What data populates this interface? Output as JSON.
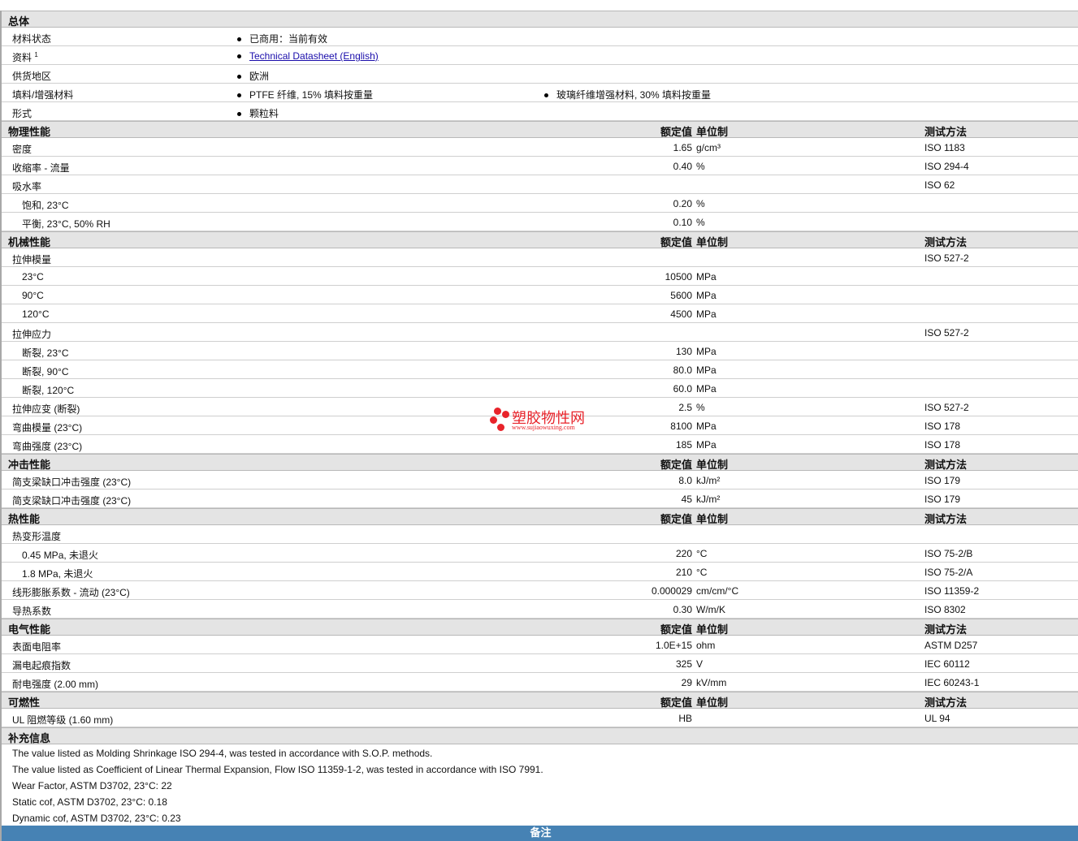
{
  "general": {
    "title": "总体",
    "rows": [
      {
        "label": "材料状态",
        "items": [
          "已商用：当前有效"
        ]
      },
      {
        "label": "资料",
        "sup": "1",
        "items": [
          "Technical Datasheet (English)"
        ],
        "link": true
      },
      {
        "label": "供货地区",
        "items": [
          "欧洲"
        ]
      },
      {
        "label": "填料/增强材料",
        "items": [
          "PTFE 纤维, 15% 填料按重量",
          "玻璃纤维增强材料, 30% 填料按重量"
        ]
      },
      {
        "label": "形式",
        "items": [
          "颗粒料"
        ]
      }
    ]
  },
  "headers": {
    "value": "额定值",
    "unit": "单位制",
    "method": "测试方法"
  },
  "sections": [
    {
      "title": "物理性能",
      "rows": [
        {
          "label": "密度",
          "value": "1.65",
          "unit": "g/cm³",
          "method": "ISO 1183"
        },
        {
          "label": "收缩率 - 流量",
          "value": "0.40",
          "unit": "%",
          "method": "ISO 294-4"
        },
        {
          "label": "吸水率",
          "method": "ISO 62"
        },
        {
          "label": "饱和, 23°C",
          "indent": true,
          "value": "0.20",
          "unit": "%"
        },
        {
          "label": "平衡, 23°C, 50% RH",
          "indent": true,
          "value": "0.10",
          "unit": "%"
        }
      ]
    },
    {
      "title": "机械性能",
      "rows": [
        {
          "label": "拉伸模量",
          "method": "ISO 527-2"
        },
        {
          "label": "23°C",
          "indent": true,
          "value": "10500",
          "unit": "MPa"
        },
        {
          "label": "90°C",
          "indent": true,
          "value": "5600",
          "unit": "MPa"
        },
        {
          "label": "120°C",
          "indent": true,
          "value": "4500",
          "unit": "MPa"
        },
        {
          "label": "拉伸应力",
          "method": "ISO 527-2"
        },
        {
          "label": "断裂, 23°C",
          "indent": true,
          "value": "130",
          "unit": "MPa"
        },
        {
          "label": "断裂, 90°C",
          "indent": true,
          "value": "80.0",
          "unit": "MPa"
        },
        {
          "label": "断裂, 120°C",
          "indent": true,
          "value": "60.0",
          "unit": "MPa"
        },
        {
          "label": "拉伸应变 (断裂)",
          "value": "2.5",
          "unit": "%",
          "method": "ISO 527-2"
        },
        {
          "label": "弯曲模量 (23°C)",
          "value": "8100",
          "unit": "MPa",
          "method": "ISO 178"
        },
        {
          "label": "弯曲强度 (23°C)",
          "value": "185",
          "unit": "MPa",
          "method": "ISO 178"
        }
      ]
    },
    {
      "title": "冲击性能",
      "rows": [
        {
          "label": "简支梁缺口冲击强度 (23°C)",
          "value": "8.0",
          "unit": "kJ/m²",
          "method": "ISO 179"
        },
        {
          "label": "简支梁缺口冲击强度 (23°C)",
          "value": "45",
          "unit": "kJ/m²",
          "method": "ISO 179"
        }
      ]
    },
    {
      "title": "热性能",
      "rows": [
        {
          "label": "热变形温度"
        },
        {
          "label": "0.45 MPa, 未退火",
          "indent": true,
          "value": "220",
          "unit": "°C",
          "method": "ISO 75-2/B"
        },
        {
          "label": "1.8 MPa, 未退火",
          "indent": true,
          "value": "210",
          "unit": "°C",
          "method": "ISO 75-2/A"
        },
        {
          "label": "线形膨胀系数 - 流动 (23°C)",
          "value": "0.000029",
          "unit": "cm/cm/°C",
          "method": "ISO 11359-2"
        },
        {
          "label": "导热系数",
          "value": "0.30",
          "unit": "W/m/K",
          "method": "ISO 8302"
        }
      ]
    },
    {
      "title": "电气性能",
      "rows": [
        {
          "label": "表面电阻率",
          "value": "1.0E+15",
          "unit": "ohm",
          "method": "ASTM D257"
        },
        {
          "label": "漏电起痕指数",
          "value": "325",
          "unit": "V",
          "method": "IEC 60112"
        },
        {
          "label": "耐电强度 (2.00 mm)",
          "value": "29",
          "unit": "kV/mm",
          "method": "IEC 60243-1"
        }
      ]
    },
    {
      "title": "可燃性",
      "rows": [
        {
          "label": "UL 阻燃等级 (1.60 mm)",
          "value": "HB",
          "method": "UL 94"
        }
      ]
    }
  ],
  "supplement": {
    "title": "补充信息",
    "notes": [
      "The value listed as Molding Shrinkage ISO 294-4, was tested in accordance with S.O.P. methods.",
      "The value listed as Coefficient of Linear Thermal Expansion, Flow ISO 11359-1-2, was tested in accordance with ISO 7991.",
      "Wear Factor, ASTM D3702, 23°C: 22",
      "Static cof, ASTM D3702, 23°C: 0.18",
      "Dynamic cof, ASTM D3702, 23°C: 0.23"
    ]
  },
  "footer": {
    "label": "备注"
  },
  "watermark": {
    "name": "塑胶物性网",
    "url": "www.sujiaowuxing.com"
  }
}
